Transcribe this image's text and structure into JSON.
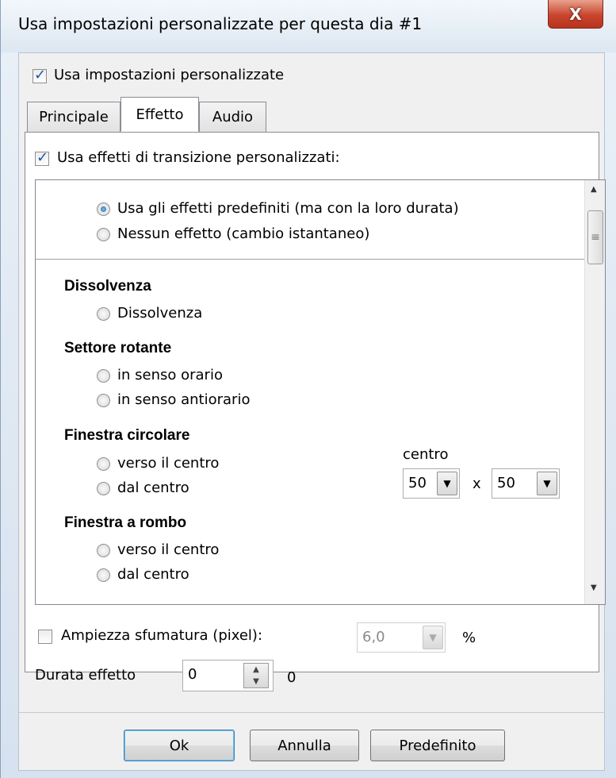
{
  "window": {
    "title": "Usa impostazioni personalizzate per questa dia #1",
    "close_label": "X"
  },
  "custom_settings": {
    "label": "Usa impostazioni personalizzate",
    "checked": true
  },
  "tabs": [
    {
      "label": "Principale",
      "active": false
    },
    {
      "label": "Effetto",
      "active": true
    },
    {
      "label": "Audio",
      "active": false
    }
  ],
  "custom_transitions": {
    "label": "Usa effetti di transizione personalizzati:",
    "checked": true
  },
  "effect_list": {
    "default_effects": "Usa gli effetti predefiniti (ma con la loro durata)",
    "no_effect": "Nessun effetto (cambio istantaneo)",
    "sections": {
      "dissolve": {
        "title": "Dissolvenza",
        "options": [
          "Dissolvenza"
        ]
      },
      "rotating": {
        "title": "Settore rotante",
        "options": [
          "in senso orario",
          "in senso antiorario"
        ]
      },
      "circle": {
        "title": "Finestra circolare",
        "options": [
          "verso il centro",
          "dal centro"
        ]
      },
      "diamond": {
        "title": "Finestra a rombo",
        "options": [
          "verso il centro",
          "dal centro"
        ]
      }
    },
    "center": {
      "label": "centro",
      "x_value": "50",
      "y_value": "50",
      "separator": "x"
    }
  },
  "feather": {
    "label": "Ampiezza sfumatura (pixel):",
    "checked": false,
    "value": "6,0",
    "unit": "%"
  },
  "duration": {
    "label": "Durata effetto",
    "value": "0",
    "suffix": "0"
  },
  "buttons": {
    "ok": "Ok",
    "cancel": "Annulla",
    "default": "Predefinito"
  },
  "colors": {
    "accent": "#3c7fb1",
    "close": "#c9452d"
  }
}
